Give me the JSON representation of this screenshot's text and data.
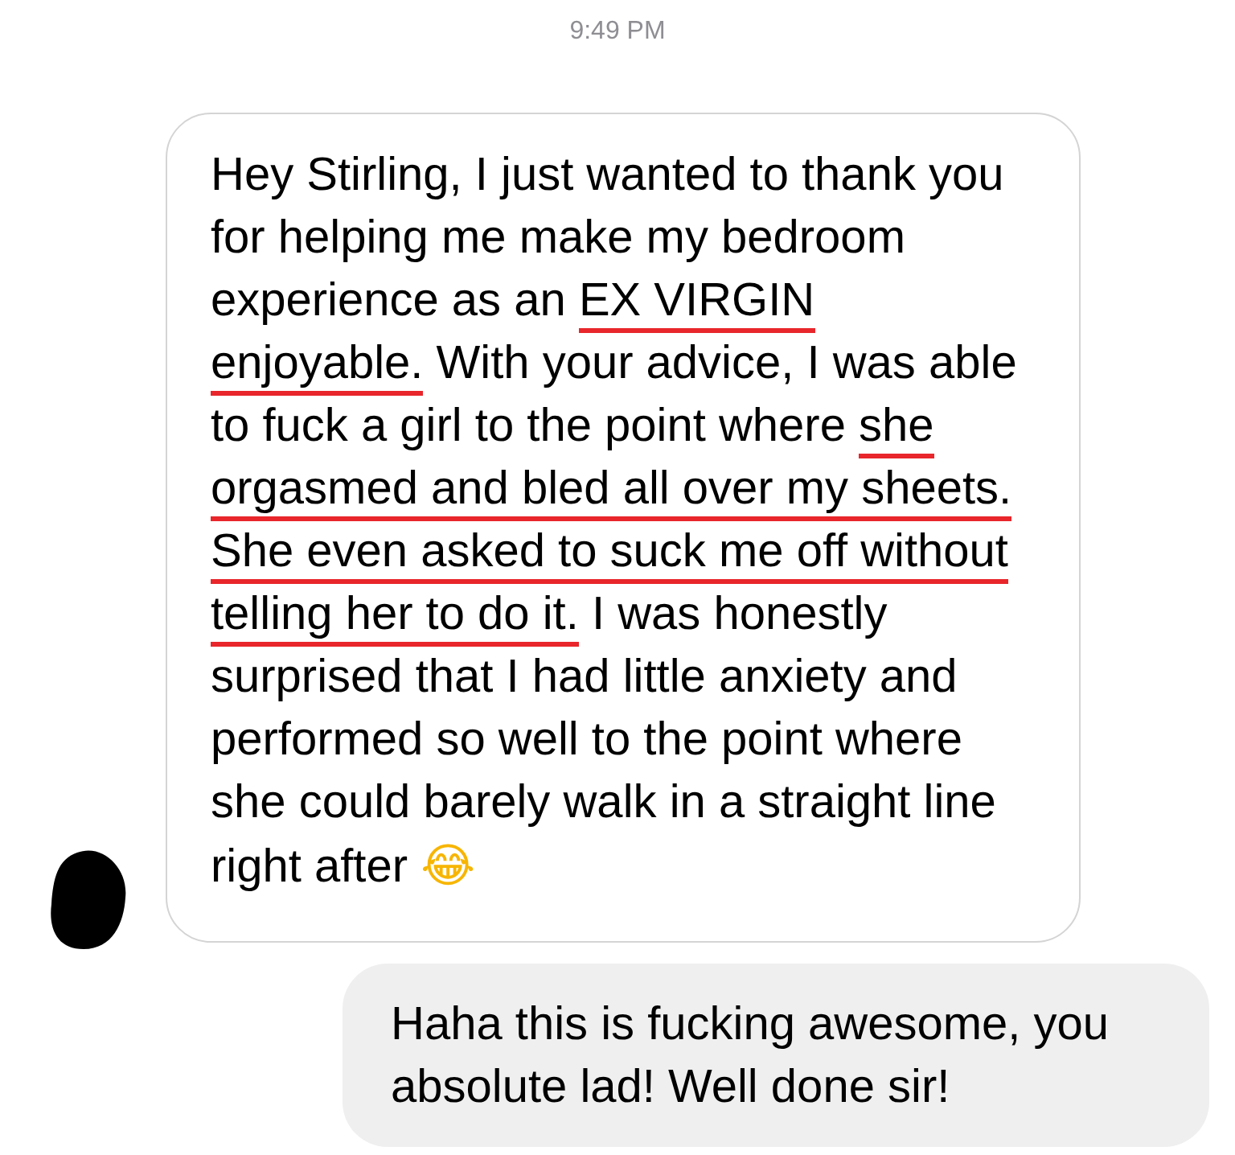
{
  "timestamp": "9:49 PM",
  "messages": [
    {
      "kind": "received",
      "segments": [
        {
          "text": "Hey Stirling, I just wanted to thank you for helping me make my bedroom experience as an ",
          "underlined": false
        },
        {
          "text": "EX VIRGIN enjoyable.",
          "underlined": true
        },
        {
          "text": " With your advice, I was able to fuck a girl to the point where ",
          "underlined": false
        },
        {
          "text": "she orgasmed and bled all over my sheets. She even asked to suck me off without telling her to do it.",
          "underlined": true
        },
        {
          "text": " I was honestly surprised that I had little anxiety and performed so well to the point where she could barely walk in a straight line right after ",
          "underlined": false
        }
      ],
      "emoji": "😂"
    },
    {
      "kind": "sent",
      "segments": [
        {
          "text": "Haha this is fucking awesome, you absolute lad! Well done sir!",
          "underlined": false
        }
      ]
    }
  ]
}
